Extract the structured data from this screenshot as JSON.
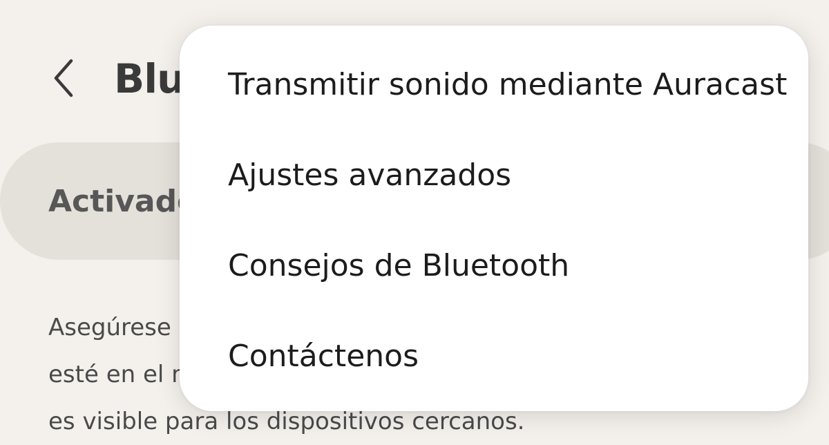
{
  "screen": {
    "title": "Bluetooth",
    "master_switch_label": "Activado",
    "description_lines": [
      "Asegúrese de que el dispositivo que quiere conectar",
      "esté en el modo de vinculación. Su teléfono",
      "es visible para los dispositivos cercanos."
    ]
  },
  "icons": {
    "back": "chevron-left-icon"
  },
  "menu": {
    "items": [
      {
        "label": "Transmitir sonido mediante Auracast"
      },
      {
        "label": "Ajustes avanzados"
      },
      {
        "label": "Consejos de Bluetooth"
      },
      {
        "label": "Contáctenos"
      }
    ]
  },
  "colors": {
    "background": "#f4f0ec",
    "switch_row": "#e4e0da",
    "menu_surface": "#ffffff",
    "text_primary": "#1c1c1c"
  }
}
